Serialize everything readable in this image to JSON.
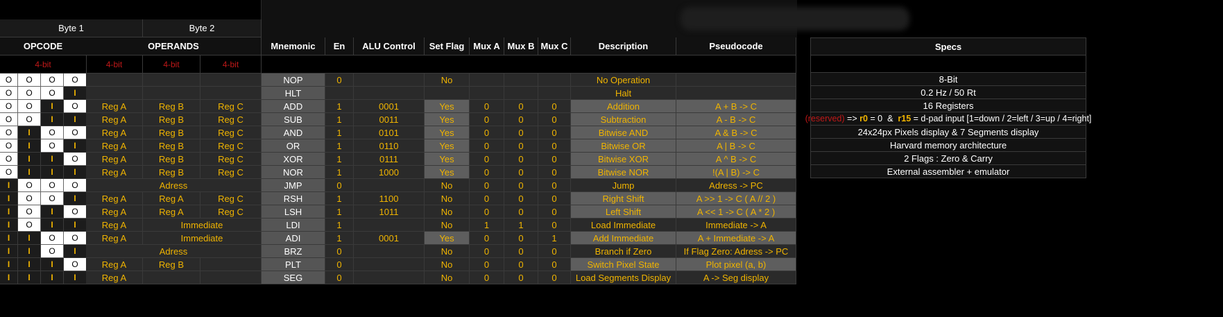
{
  "header": {
    "byte1": "Byte 1",
    "byte2": "Byte 2",
    "opcode": "OPCODE",
    "operands": "OPERANDS",
    "mnemonic": "Mnemonic",
    "en": "En",
    "alu_control": "ALU Control",
    "set_flag": "Set Flag",
    "mux_a": "Mux A",
    "mux_b": "Mux B",
    "mux_c": "Mux C",
    "description": "Description",
    "pseudocode": "Pseudocode",
    "bit_sizes": [
      "4-bit",
      "4-bit",
      "4-bit",
      "4-bit"
    ]
  },
  "instructions": [
    {
      "bits": [
        "O",
        "O",
        "O",
        "O"
      ],
      "ops": [
        "",
        "",
        ""
      ],
      "mnemonic": "NOP",
      "en": "0",
      "alu": "",
      "flag": "No",
      "mux_a": "",
      "mux_b": "",
      "mux_c": "",
      "desc": "No Operation",
      "pseudo": ""
    },
    {
      "bits": [
        "O",
        "O",
        "O",
        "I"
      ],
      "ops": [
        "",
        "",
        ""
      ],
      "mnemonic": "HLT",
      "en": "",
      "alu": "",
      "flag": "",
      "mux_a": "",
      "mux_b": "",
      "mux_c": "",
      "desc": "Halt",
      "pseudo": ""
    },
    {
      "bits": [
        "O",
        "O",
        "I",
        "O"
      ],
      "ops": [
        "Reg A",
        "Reg B",
        "Reg C"
      ],
      "mnemonic": "ADD",
      "en": "1",
      "alu": "0001",
      "flag": "Yes",
      "mux_a": "0",
      "mux_b": "0",
      "mux_c": "0",
      "desc": "Addition",
      "pseudo": "A + B -> C"
    },
    {
      "bits": [
        "O",
        "O",
        "I",
        "I"
      ],
      "ops": [
        "Reg A",
        "Reg B",
        "Reg C"
      ],
      "mnemonic": "SUB",
      "en": "1",
      "alu": "0011",
      "flag": "Yes",
      "mux_a": "0",
      "mux_b": "0",
      "mux_c": "0",
      "desc": "Subtraction",
      "pseudo": "A - B -> C"
    },
    {
      "bits": [
        "O",
        "I",
        "O",
        "O"
      ],
      "ops": [
        "Reg A",
        "Reg B",
        "Reg C"
      ],
      "mnemonic": "AND",
      "en": "1",
      "alu": "0101",
      "flag": "Yes",
      "mux_a": "0",
      "mux_b": "0",
      "mux_c": "0",
      "desc": "Bitwise AND",
      "pseudo": "A & B -> C"
    },
    {
      "bits": [
        "O",
        "I",
        "O",
        "I"
      ],
      "ops": [
        "Reg A",
        "Reg B",
        "Reg C"
      ],
      "mnemonic": "OR",
      "en": "1",
      "alu": "0110",
      "flag": "Yes",
      "mux_a": "0",
      "mux_b": "0",
      "mux_c": "0",
      "desc": "Bitwise OR",
      "pseudo": "A | B -> C"
    },
    {
      "bits": [
        "O",
        "I",
        "I",
        "O"
      ],
      "ops": [
        "Reg A",
        "Reg B",
        "Reg C"
      ],
      "mnemonic": "XOR",
      "en": "1",
      "alu": "0111",
      "flag": "Yes",
      "mux_a": "0",
      "mux_b": "0",
      "mux_c": "0",
      "desc": "Bitwise XOR",
      "pseudo": "A ^ B -> C"
    },
    {
      "bits": [
        "O",
        "I",
        "I",
        "I"
      ],
      "ops": [
        "Reg A",
        "Reg B",
        "Reg C"
      ],
      "mnemonic": "NOR",
      "en": "1",
      "alu": "1000",
      "flag": "Yes",
      "mux_a": "0",
      "mux_b": "0",
      "mux_c": "0",
      "desc": "Bitwise NOR",
      "pseudo": "!(A | B) -> C"
    },
    {
      "bits": [
        "I",
        "O",
        "O",
        "O"
      ],
      "ops": [
        "Adress",
        "",
        ""
      ],
      "opspan": "all",
      "mnemonic": "JMP",
      "en": "0",
      "alu": "",
      "flag": "No",
      "mux_a": "0",
      "mux_b": "0",
      "mux_c": "0",
      "desc": "Jump",
      "pseudo": "Adress -> PC"
    },
    {
      "bits": [
        "I",
        "O",
        "O",
        "I"
      ],
      "ops": [
        "Reg A",
        "Reg A",
        "Reg C"
      ],
      "mnemonic": "RSH",
      "en": "1",
      "alu": "1100",
      "flag": "No",
      "mux_a": "0",
      "mux_b": "0",
      "mux_c": "0",
      "desc": "Right Shift",
      "pseudo": "A >> 1 -> C      ( A // 2 )"
    },
    {
      "bits": [
        "I",
        "O",
        "I",
        "O"
      ],
      "ops": [
        "Reg A",
        "Reg A",
        "Reg C"
      ],
      "mnemonic": "LSH",
      "en": "1",
      "alu": "1011",
      "flag": "No",
      "mux_a": "0",
      "mux_b": "0",
      "mux_c": "0",
      "desc": "Left Shift",
      "pseudo": "A << 1 -> C      ( A * 2 )"
    },
    {
      "bits": [
        "I",
        "O",
        "I",
        "I"
      ],
      "ops": [
        "Reg A",
        "Immediate",
        ""
      ],
      "opspan": "imm",
      "mnemonic": "LDI",
      "en": "1",
      "alu": "",
      "flag": "No",
      "mux_a": "1",
      "mux_b": "1",
      "mux_c": "0",
      "desc": "Load Immediate",
      "pseudo": "Immediate -> A"
    },
    {
      "bits": [
        "I",
        "I",
        "O",
        "O"
      ],
      "ops": [
        "Reg A",
        "Immediate",
        ""
      ],
      "opspan": "imm",
      "mnemonic": "ADI",
      "en": "1",
      "alu": "0001",
      "flag": "Yes",
      "mux_a": "0",
      "mux_b": "0",
      "mux_c": "1",
      "desc": "Add Immediate",
      "pseudo": "A + Immediate -> A"
    },
    {
      "bits": [
        "I",
        "I",
        "O",
        "I"
      ],
      "ops": [
        "Adress",
        "",
        ""
      ],
      "opspan": "all",
      "mnemonic": "BRZ",
      "en": "0",
      "alu": "",
      "flag": "No",
      "mux_a": "0",
      "mux_b": "0",
      "mux_c": "0",
      "desc": "Branch if Zero",
      "pseudo": "If  Flag Zero: Adress -> PC"
    },
    {
      "bits": [
        "I",
        "I",
        "I",
        "O"
      ],
      "ops": [
        "Reg A",
        "Reg B",
        ""
      ],
      "mnemonic": "PLT",
      "en": "0",
      "alu": "",
      "flag": "No",
      "mux_a": "0",
      "mux_b": "0",
      "mux_c": "0",
      "desc": "Switch Pixel State",
      "pseudo": "Plot pixel (a, b)"
    },
    {
      "bits": [
        "I",
        "I",
        "I",
        "I"
      ],
      "ops": [
        "Reg A",
        "",
        ""
      ],
      "mnemonic": "SEG",
      "en": "0",
      "alu": "",
      "flag": "No",
      "mux_a": "0",
      "mux_b": "0",
      "mux_c": "0",
      "desc": "Load Segments Display",
      "pseudo": "A -> Seg display"
    }
  ],
  "specs": {
    "title": "Specs",
    "items": [
      "8-Bit",
      "0.2 Hz / 50 Rt",
      "16 Registers",
      "24x24px Pixels display & 7 Segments display",
      "Harvard memory architecture",
      "2 Flags : Zero & Carry",
      "External assembler + emulator"
    ],
    "reserved": {
      "prefix": "(reserved)",
      "arrow": " => ",
      "r0": "r0",
      "mid": " = 0  &  ",
      "r15": "r15",
      "suffix": " = d-pad input [1=down / 2=left / 3=up / 4=right]"
    }
  },
  "colors": {
    "accent": "#f0b400",
    "bitsize": "#c01818",
    "background": "#000000"
  }
}
